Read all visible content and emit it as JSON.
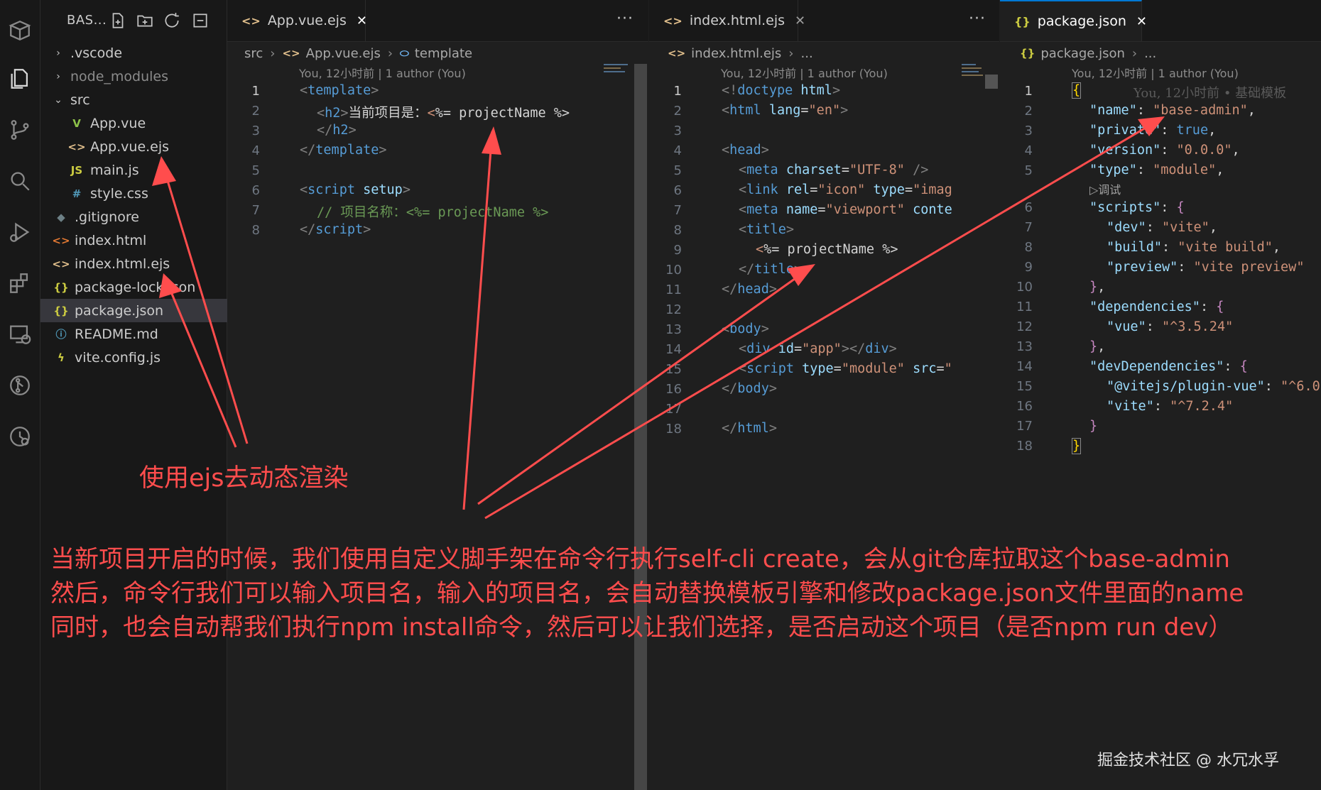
{
  "activity_bar": [
    "box-icon",
    "explorer-icon",
    "source-control-icon",
    "search-icon",
    "run-debug-icon",
    "extensions-icon",
    "remote-explorer-icon",
    "git-graph-icon",
    "timeline-icon"
  ],
  "explorer": {
    "title": "BAS...",
    "items": [
      {
        "label": ".vscode",
        "kind": "folder",
        "icon": "›"
      },
      {
        "label": "node_modules",
        "kind": "folder",
        "icon": "›"
      },
      {
        "label": "src",
        "kind": "folder-open",
        "icon": "⌄"
      },
      {
        "label": "App.vue",
        "kind": "vue",
        "icon": "V"
      },
      {
        "label": "App.vue.ejs",
        "kind": "ejs",
        "icon": "<>"
      },
      {
        "label": "main.js",
        "kind": "js",
        "icon": "JS"
      },
      {
        "label": "style.css",
        "kind": "css",
        "icon": "#"
      },
      {
        "label": ".gitignore",
        "kind": "git",
        "icon": "◆"
      },
      {
        "label": "index.html",
        "kind": "html",
        "icon": "<>"
      },
      {
        "label": "index.html.ejs",
        "kind": "ejs",
        "icon": "<>"
      },
      {
        "label": "package-lock.json",
        "kind": "json",
        "icon": "{}"
      },
      {
        "label": "package.json",
        "kind": "json",
        "icon": "{}"
      },
      {
        "label": "README.md",
        "kind": "info",
        "icon": "ⓘ"
      },
      {
        "label": "vite.config.js",
        "kind": "vite",
        "icon": "ϟ"
      }
    ]
  },
  "editor1": {
    "tab": "App.vue.ejs",
    "crumbs": [
      "src",
      "App.vue.ejs",
      "template"
    ],
    "blame": "You, 12小时前 | 1 author (You)",
    "lines": [
      "1",
      "2",
      "3",
      "4",
      "5",
      "6",
      "7",
      "8"
    ]
  },
  "editor2": {
    "tab": "index.html.ejs",
    "crumbs": [
      "index.html.ejs",
      "..."
    ],
    "blame": "You, 12小时前 | 1 author (You)",
    "lines": [
      "1",
      "2",
      "3",
      "4",
      "5",
      "6",
      "7",
      "8",
      "9",
      "10",
      "11",
      "12",
      "13",
      "14",
      "15",
      "16",
      "17",
      "18"
    ]
  },
  "editor3": {
    "tab": "package.json",
    "crumbs": [
      "package.json",
      "..."
    ],
    "blame": "You, 12小时前 | 1 author (You)",
    "inline_blame": "You, 12小时前 • 基础模板",
    "codelens": "▷调试",
    "lines": [
      "1",
      "2",
      "3",
      "4",
      "5",
      "6",
      "7",
      "8",
      "9",
      "10",
      "11",
      "12",
      "13",
      "14",
      "15",
      "16",
      "17",
      "18"
    ]
  },
  "tab_close": "✕",
  "more_actions": "···",
  "annotations": {
    "label1": "使用ejs去动态渲染",
    "para": [
      "当新项目开启的时候，我们使用自定义脚手架在命令行执行self-cli create，会从git仓库拉取这个base-admin",
      "然后，命令行我们可以输入项目名，输入的项目名，会自动替换模板引擎和修改package.json文件里面的name",
      "同时，也会自动帮我们执行npm install命令，然后可以让我们选择，是否启动这个项目（是否npm run dev）"
    ],
    "color": "#ff4d4d"
  },
  "watermark": "掘金技术社区 @ 水冗水孚"
}
